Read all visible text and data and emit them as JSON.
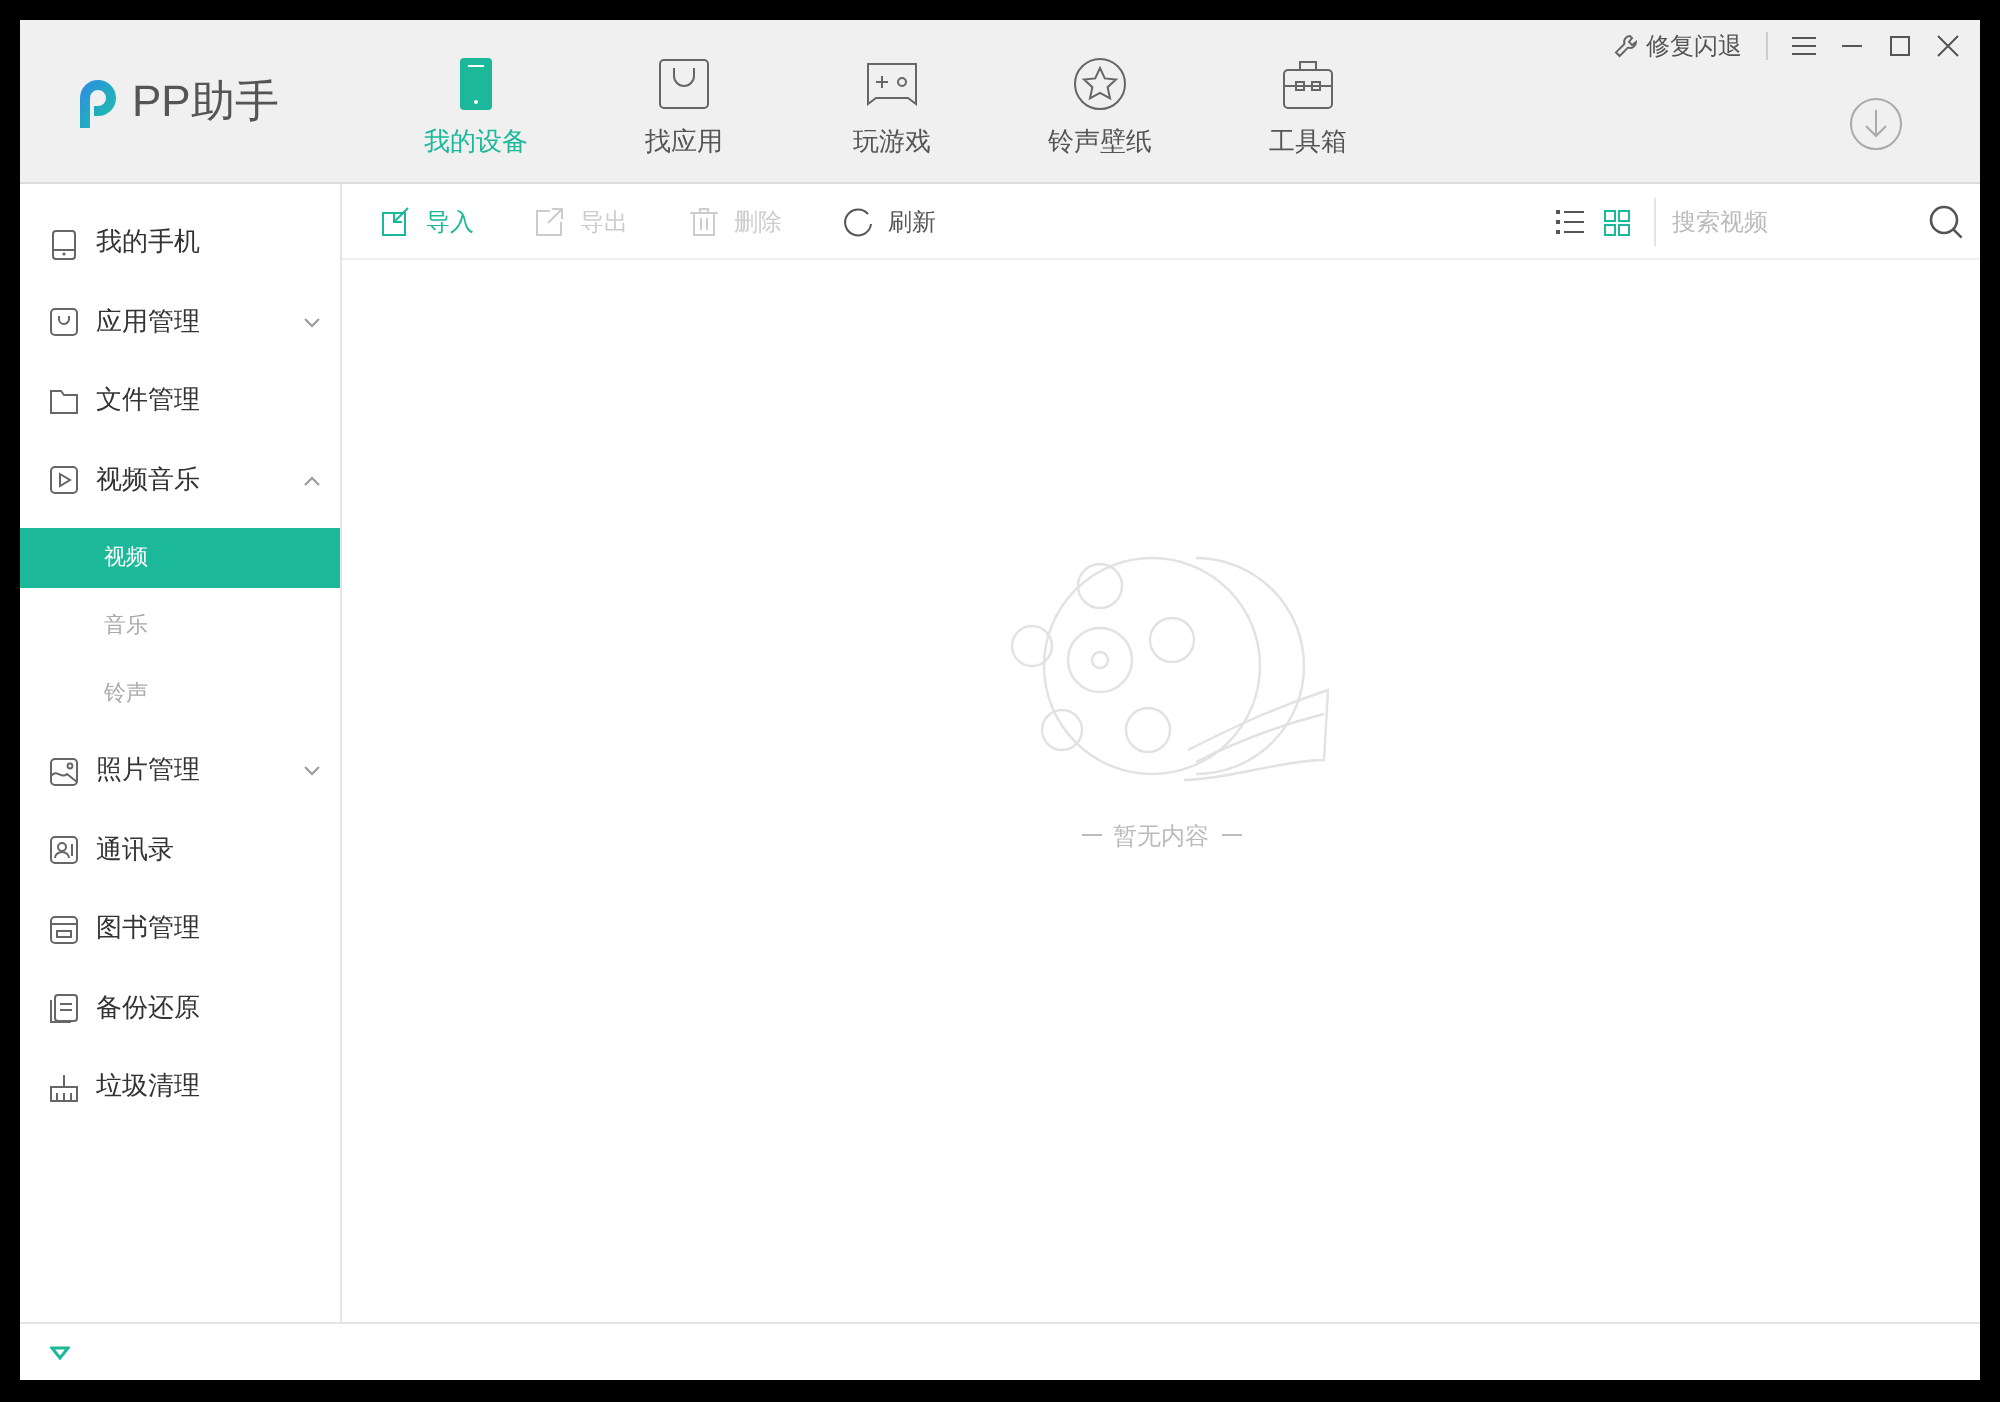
{
  "title_bar": {
    "logo": "PP助手",
    "repair": "修复闪退"
  },
  "nav_tabs": [
    {
      "label": "我的设备",
      "kind": "device",
      "selected": true
    },
    {
      "label": "找应用",
      "kind": "bag",
      "selected": false
    },
    {
      "label": "玩游戏",
      "kind": "game",
      "selected": false
    },
    {
      "label": "铃声壁纸",
      "kind": "star",
      "selected": false
    },
    {
      "label": "工具箱",
      "kind": "toolbox",
      "selected": false
    }
  ],
  "sidebar": {
    "items": [
      {
        "label": "我的手机",
        "kind": "phone",
        "selected": false
      },
      {
        "label": "应用管理",
        "kind": "bag",
        "selected": false,
        "expanded": false
      },
      {
        "label": "文件管理",
        "kind": "folder",
        "selected": false
      },
      {
        "label": "视频音乐",
        "kind": "play",
        "selected": false,
        "expanded": true,
        "children": [
          {
            "label": "视频",
            "selected": true
          },
          {
            "label": "音乐",
            "selected": false
          },
          {
            "label": "铃声",
            "selected": false
          }
        ]
      },
      {
        "label": "照片管理",
        "kind": "photo",
        "selected": false,
        "expanded": false
      },
      {
        "label": "通讯录",
        "kind": "contact",
        "selected": false
      },
      {
        "label": "图书管理",
        "kind": "book",
        "selected": false
      },
      {
        "label": "备份还原",
        "kind": "backup",
        "selected": false
      },
      {
        "label": "垃圾清理",
        "kind": "clean",
        "selected": false
      }
    ]
  },
  "toolbar": {
    "actions": [
      {
        "label": "导入",
        "kind": "import",
        "disabled": false
      },
      {
        "label": "导出",
        "kind": "export",
        "disabled": true
      },
      {
        "label": "删除",
        "kind": "delete",
        "disabled": true
      },
      {
        "label": "刷新",
        "kind": "refresh",
        "disabled": false
      }
    ],
    "view_modes": [
      {
        "kind": "list",
        "selected": false
      },
      {
        "kind": "grid",
        "selected": true
      }
    ],
    "search": {
      "placeholder": "搜索视频"
    }
  },
  "empty_state": {
    "text": "暂无内容"
  }
}
